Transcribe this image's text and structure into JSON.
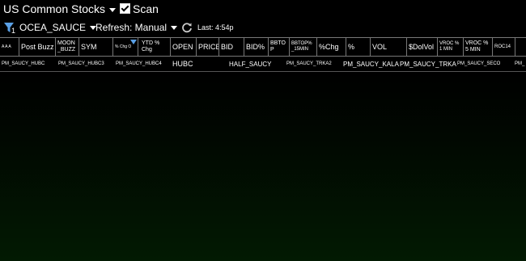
{
  "window": {
    "title": "US Common Stocks",
    "scan_label": "Scan",
    "scan_checked": true
  },
  "toolbar": {
    "filter_count": "1",
    "layout": "OCEA_SAUCE",
    "refresh": "Refresh: Manual",
    "last": "Last: 4:54p"
  },
  "columns": [
    {
      "label": "A A A"
    },
    {
      "label": "Post Buzz"
    },
    {
      "label": "MOON _BUZZ"
    },
    {
      "label": "SYM"
    },
    {
      "label": "% Chg O"
    },
    {
      "label": "YTD % Chg"
    },
    {
      "label": "OPEN"
    },
    {
      "label": "PRICE"
    },
    {
      "label": "BID"
    },
    {
      "label": "BID%"
    },
    {
      "label": "BBTO P"
    },
    {
      "label": "BBTOP% _15MIN"
    },
    {
      "label": "%Chg"
    },
    {
      "label": "%"
    },
    {
      "label": "VOL"
    },
    {
      "label": "$DolVol"
    },
    {
      "label": "VROC % 1 MIN"
    },
    {
      "label": "VROC % 5 MIN"
    },
    {
      "label": "ROC14"
    }
  ],
  "rows": [
    {
      "c1": "PM_SAUCY_HUBC",
      "c2": "PM_SAUCY_HUBC3",
      "c3": "PM_SAUCY_HUBC4",
      "c4": "HUBC",
      "c5": "HALF_SAUCY",
      "c6": "PM_SAUCY_TRKA2",
      "c7": "PM_SAUCY_KALA",
      "c8": "PM_SAUCY_TRKA",
      "c9": "PM_SAUCY_SECO",
      "c10": "PM_"
    }
  ],
  "colors": {
    "accent": "#5aa0e6",
    "background": "#000000",
    "grid": "#777777"
  }
}
